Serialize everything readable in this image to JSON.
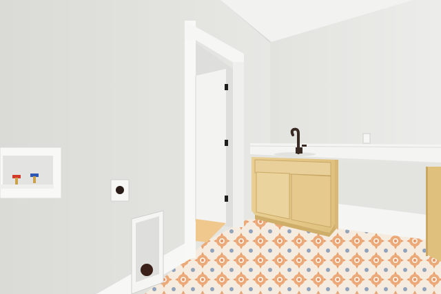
{
  "scene": {
    "description_tags": [
      "laundry-room",
      "utility-sink",
      "washer-box",
      "dryer-vent",
      "tiled-floor"
    ],
    "colors": {
      "left_wall": "#e2e2df",
      "right_wall": "#e6e6e3",
      "ceiling": "#f1f1ef",
      "trim": "#f7f7f5",
      "cabinet": "#e8cd90",
      "cabinet_shadow": "#cfae6a",
      "countertop": "#f4f4f2",
      "floor_base": "#f2e6d8",
      "tile_orange": "#e8955a",
      "tile_blue": "#7b8fae",
      "faucet": "#3a2a24"
    }
  }
}
